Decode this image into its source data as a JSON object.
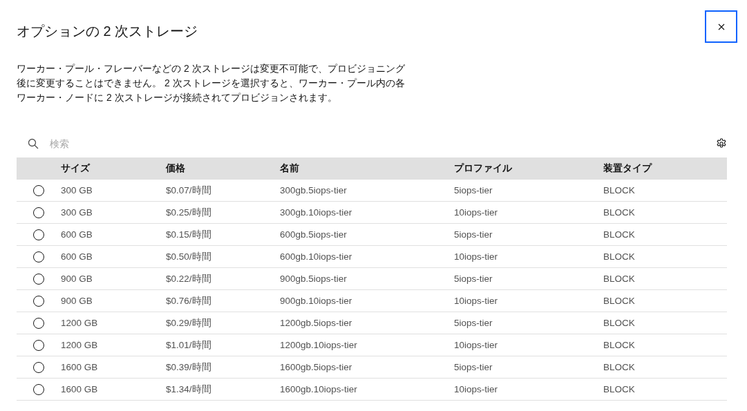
{
  "dialog": {
    "title": "オプションの 2 次ストレージ",
    "description": "ワーカー・プール・フレーバーなどの 2 次ストレージは変更不可能で、プロビジョニング後に変更することはできません。 2 次ストレージを選択すると、ワーカー・プール内の各ワーカー・ノードに 2 次ストレージが接続されてプロビジョンされます。"
  },
  "search": {
    "placeholder": "検索"
  },
  "table": {
    "columns": [
      "サイズ",
      "価格",
      "名前",
      "プロファイル",
      "装置タイプ"
    ],
    "rows": [
      {
        "selected": false,
        "cells": [
          "300 GB",
          "$0.07/時間",
          "300gb.5iops-tier",
          "5iops-tier",
          "BLOCK"
        ]
      },
      {
        "selected": false,
        "cells": [
          "300 GB",
          "$0.25/時間",
          "300gb.10iops-tier",
          "10iops-tier",
          "BLOCK"
        ]
      },
      {
        "selected": false,
        "cells": [
          "600 GB",
          "$0.15/時間",
          "600gb.5iops-tier",
          "5iops-tier",
          "BLOCK"
        ]
      },
      {
        "selected": false,
        "cells": [
          "600 GB",
          "$0.50/時間",
          "600gb.10iops-tier",
          "10iops-tier",
          "BLOCK"
        ]
      },
      {
        "selected": false,
        "cells": [
          "900 GB",
          "$0.22/時間",
          "900gb.5iops-tier",
          "5iops-tier",
          "BLOCK"
        ]
      },
      {
        "selected": false,
        "cells": [
          "900 GB",
          "$0.76/時間",
          "900gb.10iops-tier",
          "10iops-tier",
          "BLOCK"
        ]
      },
      {
        "selected": false,
        "cells": [
          "1200 GB",
          "$0.29/時間",
          "1200gb.5iops-tier",
          "5iops-tier",
          "BLOCK"
        ]
      },
      {
        "selected": false,
        "cells": [
          "1200 GB",
          "$1.01/時間",
          "1200gb.10iops-tier",
          "10iops-tier",
          "BLOCK"
        ]
      },
      {
        "selected": false,
        "cells": [
          "1600 GB",
          "$0.39/時間",
          "1600gb.5iops-tier",
          "5iops-tier",
          "BLOCK"
        ]
      },
      {
        "selected": false,
        "cells": [
          "1600 GB",
          "$1.34/時間",
          "1600gb.10iops-tier",
          "10iops-tier",
          "BLOCK"
        ]
      }
    ]
  }
}
